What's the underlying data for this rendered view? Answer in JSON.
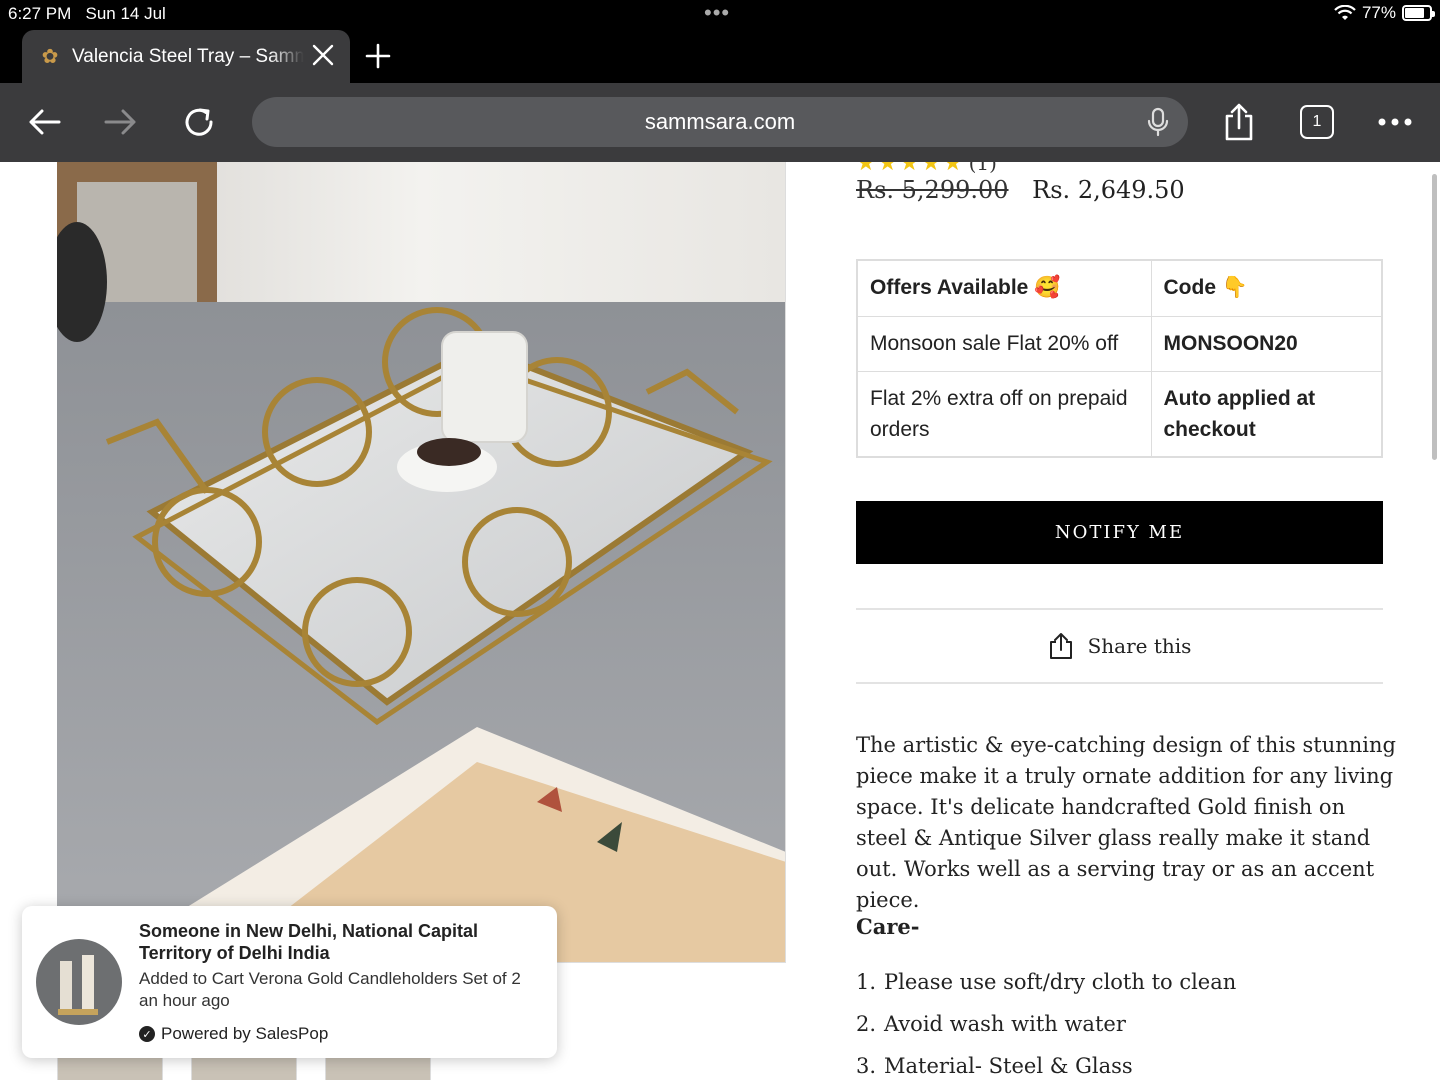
{
  "status": {
    "time": "6:27 PM",
    "date": "Sun 14 Jul",
    "battery": "77%",
    "battery_level": 0.77
  },
  "browser": {
    "tab_title": "Valencia Steel Tray – Sammsara",
    "url": "sammsara.com",
    "tab_count": "1"
  },
  "product": {
    "rating_count": "(1)",
    "rating_stars": 5,
    "price_old": "Rs. 5,299.00",
    "price_new": "Rs. 2,649.50",
    "offers": {
      "header_offer": "Offers Available 🥰",
      "header_code": "Code 👇",
      "rows": [
        {
          "offer": "Monsoon sale Flat 20% off",
          "code": "MONSOON20"
        },
        {
          "offer": "Flat 2% extra off on prepaid orders",
          "code": "Auto applied at checkout"
        }
      ]
    },
    "notify_label": "NOTIFY ME",
    "share_label": "Share this",
    "description": "The artistic & eye-catching design of this stunning piece make it a truly ornate addition for any living space. It's delicate handcrafted Gold finish on steel & Antique Silver glass really make it stand out. Works well as a serving tray or as an accent piece.",
    "care_title": "Care-",
    "care": [
      {
        "n": "1.",
        "text": "Please use soft/dry cloth to clean"
      },
      {
        "n": "2.",
        "text": "Avoid wash with water"
      },
      {
        "n": "3.",
        "text": "Material- Steel & Glass"
      }
    ]
  },
  "salespop": {
    "who": "Someone in New Delhi, National Capital Territory of Delhi India",
    "what": "Added to Cart Verona Gold Candleholders Set of 2",
    "when": "an hour ago",
    "powered": "Powered by SalesPop"
  },
  "colors": {
    "chrome_dark": "#3b3b3d",
    "urlbar": "#58595c",
    "star": "#f3c614",
    "gold": "#b08a3e"
  }
}
